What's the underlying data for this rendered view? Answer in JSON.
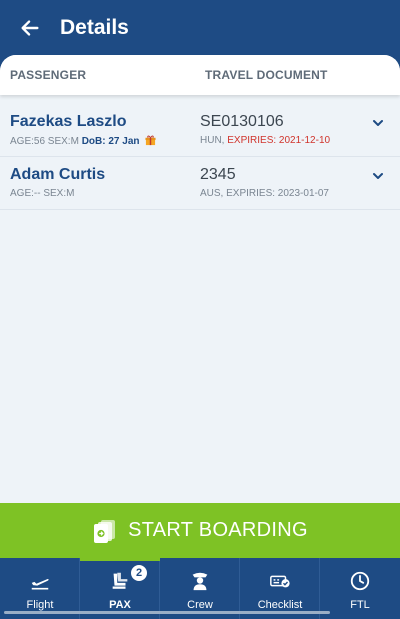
{
  "header": {
    "title": "Details"
  },
  "columns": {
    "passenger": "PASSENGER",
    "travel_document": "TRAVEL DOCUMENT"
  },
  "passengers": [
    {
      "name": "Fazekas Laszlo",
      "meta": "AGE:56 SEX:M",
      "dob": "DoB: 27 Jan",
      "doc_number": "SE0130106",
      "doc_country": "HUN,",
      "doc_expiry": "EXPIRIES: 2021-12-10",
      "expiry_color": "#d0342c"
    },
    {
      "name": "Adam Curtis",
      "meta": "AGE:-- SEX:M",
      "dob": "",
      "doc_number": "2345",
      "doc_country": "AUS,",
      "doc_expiry": "EXPIRIES: 2023-01-07",
      "expiry_color": "#7a8591"
    }
  ],
  "boarding": {
    "label": "START BOARDING"
  },
  "tabs": [
    {
      "label": "Flight",
      "icon": "plane-takeoff-icon"
    },
    {
      "label": "PAX",
      "icon": "seats-icon",
      "badge": "2",
      "active": true
    },
    {
      "label": "Crew",
      "icon": "pilot-icon"
    },
    {
      "label": "Checklist",
      "icon": "checklist-icon"
    },
    {
      "label": "FTL",
      "icon": "clock-icon"
    }
  ],
  "colors": {
    "primary": "#1e4b84",
    "accent": "#7ec225",
    "warning": "#d0342c"
  }
}
